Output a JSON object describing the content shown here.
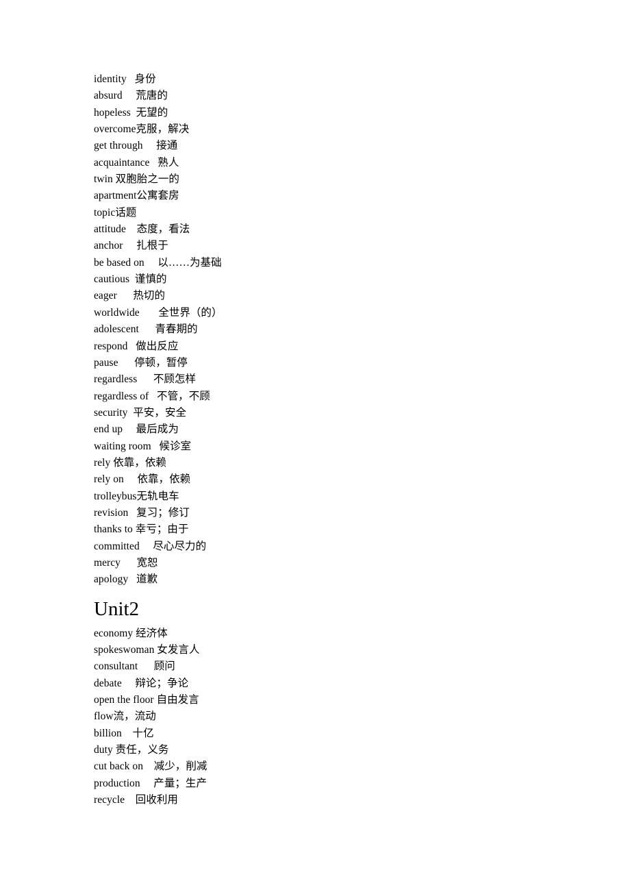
{
  "document": {
    "page_background": "#ffffff",
    "text_color": "#000000",
    "sections": [
      {
        "heading": null,
        "entries": [
          "identity   身份",
          "absurd     荒唐的",
          "hopeless  无望的",
          "overcome克服，解决",
          "get through     接通",
          "acquaintance   熟人",
          "twin 双胞胎之一的",
          "apartment公寓套房",
          "topic话题",
          "attitude    态度，看法",
          "anchor     扎根于",
          "be based on     以……为基础",
          "cautious  谨慎的",
          "eager      热切的",
          "worldwide       全世界（的）",
          "adolescent      青春期的",
          "respond   做出反应",
          "pause      停顿，暂停",
          "regardless      不顾怎样",
          "regardless of   不管，不顾",
          "security  平安，安全",
          "end up     最后成为",
          "waiting room   候诊室",
          "rely 依靠，依赖",
          "rely on     依靠，依赖",
          "trolleybus无轨电车",
          "revision   复习；修订",
          "thanks to 幸亏；由于",
          "committed     尽心尽力的",
          "mercy      宽恕",
          "apology   道歉"
        ]
      },
      {
        "heading": "Unit2",
        "entries": [
          "economy 经济体",
          "spokeswoman 女发言人",
          "consultant      顾问",
          "debate     辩论；争论",
          "open the floor 自由发言",
          "flow流，流动",
          "billion    十亿",
          "duty 责任，义务",
          "cut back on    减少，削减",
          "production     产量；生产",
          "recycle    回收利用"
        ]
      }
    ]
  }
}
